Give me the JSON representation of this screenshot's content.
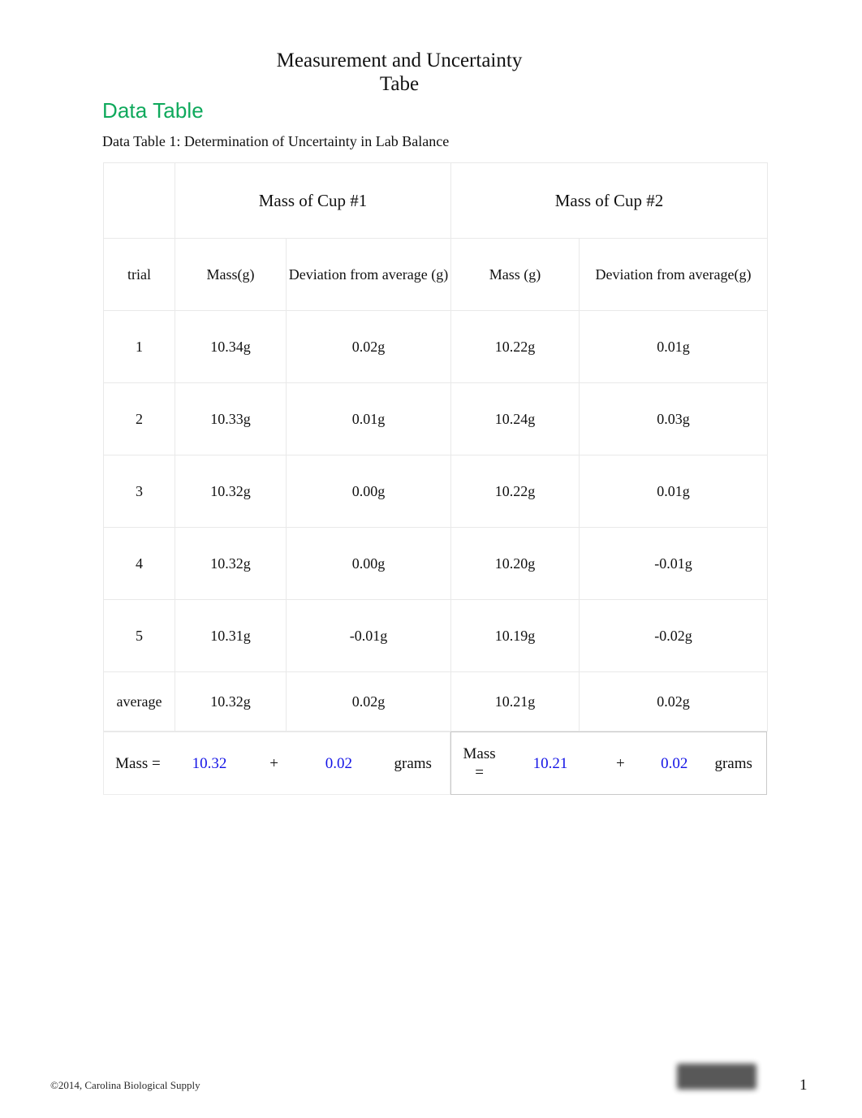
{
  "document": {
    "title_line1": "Measurement and Uncertainty",
    "title_line2": "Tabe",
    "section_heading": "Data Table",
    "table_caption": "Data Table 1: Determination of Uncertainty in Lab Balance"
  },
  "colors": {
    "heading_green": "#0FA95C",
    "value_blue": "#1414E6",
    "text_black": "#111111",
    "border_gray": "#E9E9E9"
  },
  "table": {
    "group_headers": {
      "trial_blank": "",
      "cup1": "Mass of Cup #1",
      "cup2": "Mass of Cup #2"
    },
    "column_headers": {
      "trial": "trial",
      "cup1_mass": "Mass(g)",
      "cup1_deviation": "Deviation from average (g)",
      "cup2_mass": "Mass (g)",
      "cup2_deviation": "Deviation from average(g)"
    },
    "rows": [
      {
        "trial": "1",
        "cup1_mass": "10.34g",
        "cup1_deviation": "0.02g",
        "cup2_mass": "10.22g",
        "cup2_deviation": "0.01g"
      },
      {
        "trial": "2",
        "cup1_mass": "10.33g",
        "cup1_deviation": "0.01g",
        "cup2_mass": "10.24g",
        "cup2_deviation": "0.03g"
      },
      {
        "trial": "3",
        "cup1_mass": "10.32g",
        "cup1_deviation": "0.00g",
        "cup2_mass": "10.22g",
        "cup2_deviation": "0.01g"
      },
      {
        "trial": "4",
        "cup1_mass": "10.32g",
        "cup1_deviation": "0.00g",
        "cup2_mass": "10.20g",
        "cup2_deviation": "-0.01g"
      },
      {
        "trial": "5",
        "cup1_mass": "10.31g",
        "cup1_deviation": "-0.01g",
        "cup2_mass": "10.19g",
        "cup2_deviation": "-0.02g"
      }
    ],
    "average_row": {
      "trial": "average",
      "cup1_mass": "10.32g",
      "cup1_deviation": "0.02g",
      "cup2_mass": "10.21g",
      "cup2_deviation": "0.02g"
    }
  },
  "summary": {
    "cup1": {
      "label": "Mass =",
      "value": "10.32",
      "operator": "+",
      "uncertainty": "0.02",
      "units": "grams"
    },
    "cup2": {
      "label_part1": "Mass",
      "label_part2": "=",
      "value": "10.21",
      "operator": "+",
      "uncertainty": "0.02",
      "units": "grams"
    }
  },
  "footer": {
    "copyright": "©2014, Carolina Biological Supply",
    "page_number": "1",
    "redaction_note": "redacted-logo-block"
  }
}
